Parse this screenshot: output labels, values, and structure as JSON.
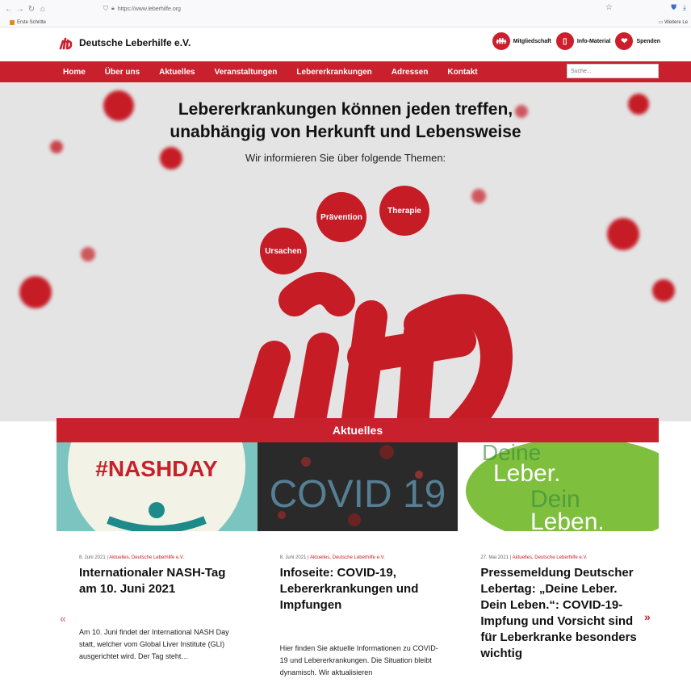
{
  "browser": {
    "url": "https://www.leberhilfe.org",
    "bookmark": "Erste Schritte",
    "bookmark_right": "Weitere Le"
  },
  "site": {
    "logo_text": "Deutsche Leberhilfe e.V.",
    "header_links": [
      {
        "label": "Mitgliedschaft",
        "icon": "people-icon"
      },
      {
        "label": "Info-Material",
        "icon": "book-icon"
      },
      {
        "label": "Spenden",
        "icon": "donate-icon"
      }
    ]
  },
  "nav": {
    "items": [
      "Home",
      "Über uns",
      "Aktuelles",
      "Veranstaltungen",
      "Lebererkrankungen",
      "Adressen",
      "Kontakt"
    ],
    "search_placeholder": "Suche..."
  },
  "hero": {
    "title_line1": "Lebererkrankungen können jeden treffen,",
    "title_line2": "unabhängig von Herkunft und Lebensweise",
    "subtitle": "Wir informieren Sie über folgende Themen:",
    "topics": [
      "Ursachen",
      "Prävention",
      "Therapie"
    ]
  },
  "news": {
    "heading": "Aktuelles",
    "cards": [
      {
        "image_text": "#NASHDAY",
        "date": "8. Juni 2021",
        "categories": "Aktuelles, Deutsche Leberhilfe e.V.",
        "title": "Internationaler NASH-Tag am 10. Juni 2021",
        "text": "Am 10. Juni findet der International NASH Day statt, welcher vom Global Liver Institute (GLI) ausgerichtet wird. Der Tag steht…"
      },
      {
        "image_text": "COVID 19",
        "date": "8. Juni 2021",
        "categories": "Aktuelles, Deutsche Leberhilfe e.V.",
        "title": "Infoseite: COVID-19, Lebererkrankungen und Impfungen",
        "text": "Hier finden Sie aktuelle Informationen zu COVID-19 und Lebererkrankungen. Die Situation bleibt dynamisch. Wir aktualisieren"
      },
      {
        "image_text_1": "Leber.",
        "image_text_2": "Dein",
        "image_text_3": "Leben.",
        "image_text_bg": "Deine",
        "date": "27. Mai 2021",
        "categories": "Aktuelles, Deutsche Leberhilfe e.V.",
        "title": "Pressemeldung Deutscher Lebertag: „Deine Leber. Dein Leben.“: COVID-19-Impfung und Vorsicht sind für Leberkranke besonders wichtig",
        "text": ""
      }
    ],
    "prev_arrow": "«",
    "next_arrow": "»"
  },
  "colors": {
    "brand_red": "#c8202c",
    "hero_bg": "#e4e4e4"
  }
}
